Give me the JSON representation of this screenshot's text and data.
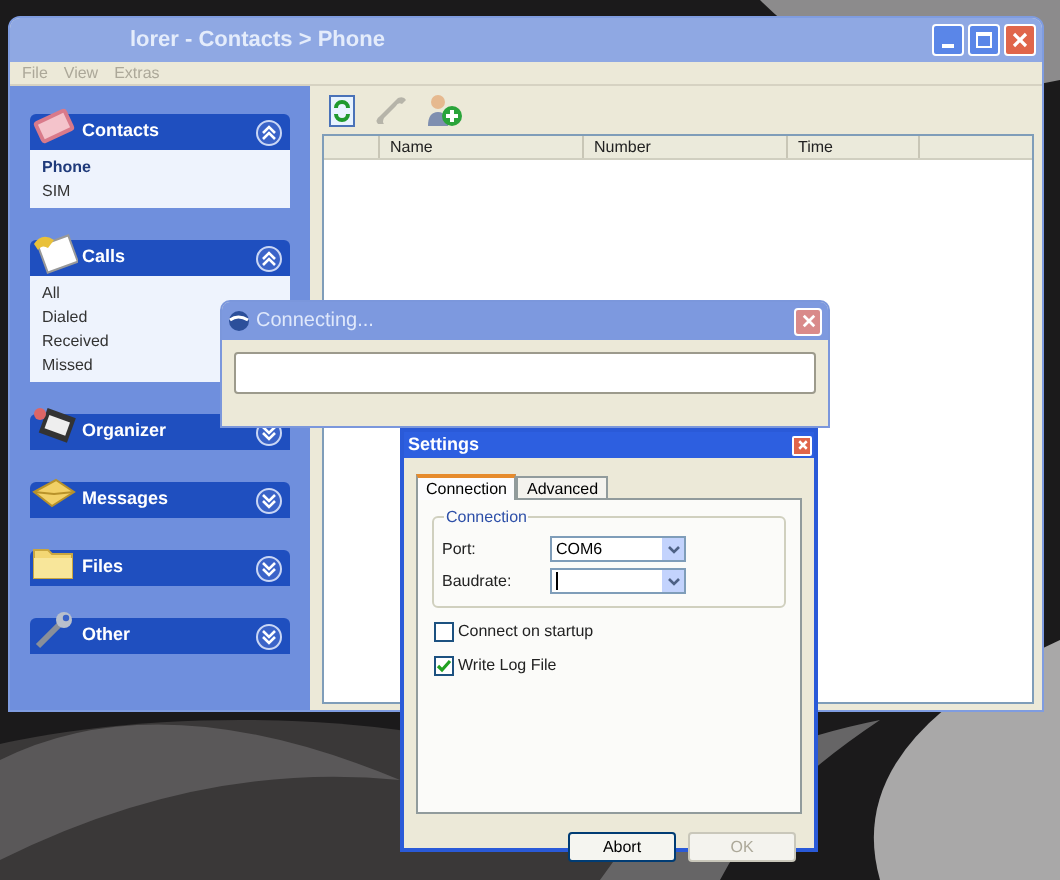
{
  "main_window": {
    "title": "lorer - Contacts > Phone",
    "menu": [
      {
        "label": "File",
        "disabled": true
      },
      {
        "label": "View",
        "disabled": true
      },
      {
        "label": "Extras",
        "disabled": true
      }
    ],
    "sidebar": {
      "groups": [
        {
          "label": "Contacts",
          "expanded": true,
          "items": [
            {
              "label": "Phone",
              "selected": true
            },
            {
              "label": "SIM",
              "selected": false
            }
          ]
        },
        {
          "label": "Calls",
          "expanded": true,
          "items": [
            {
              "label": "All",
              "selected": false
            },
            {
              "label": "Dialed",
              "selected": false
            },
            {
              "label": "Received",
              "selected": false
            },
            {
              "label": "Missed",
              "selected": false
            }
          ]
        },
        {
          "label": "Organizer",
          "expanded": false
        },
        {
          "label": "Messages",
          "expanded": false
        },
        {
          "label": "Files",
          "expanded": false
        },
        {
          "label": "Other",
          "expanded": false
        }
      ]
    },
    "toolbar": [
      {
        "kind": "refresh",
        "disabled": false
      },
      {
        "kind": "call",
        "disabled": true
      },
      {
        "kind": "add-contact",
        "disabled": false
      }
    ],
    "table": {
      "columns": [
        "Name",
        "Number",
        "Time"
      ]
    }
  },
  "connecting_dialog": {
    "title": "Connecting...",
    "level": 0
  },
  "settings_dialog": {
    "title": "Settings",
    "tabs": [
      {
        "label": "Connection",
        "selected": true
      },
      {
        "label": "Advanced",
        "selected": false
      }
    ],
    "group_label": "Connection",
    "fields": [
      {
        "label": "Port:",
        "value": "COM6",
        "focused": false
      },
      {
        "label": "Baudrate:",
        "focused": true
      }
    ],
    "checkboxes": [
      {
        "label": "Connect on startup",
        "checked": false
      },
      {
        "label": "Write Log File",
        "checked": true
      }
    ],
    "buttons": [
      {
        "label": "Abort",
        "disabled": false
      },
      {
        "label": "OK",
        "disabled": true
      }
    ]
  }
}
